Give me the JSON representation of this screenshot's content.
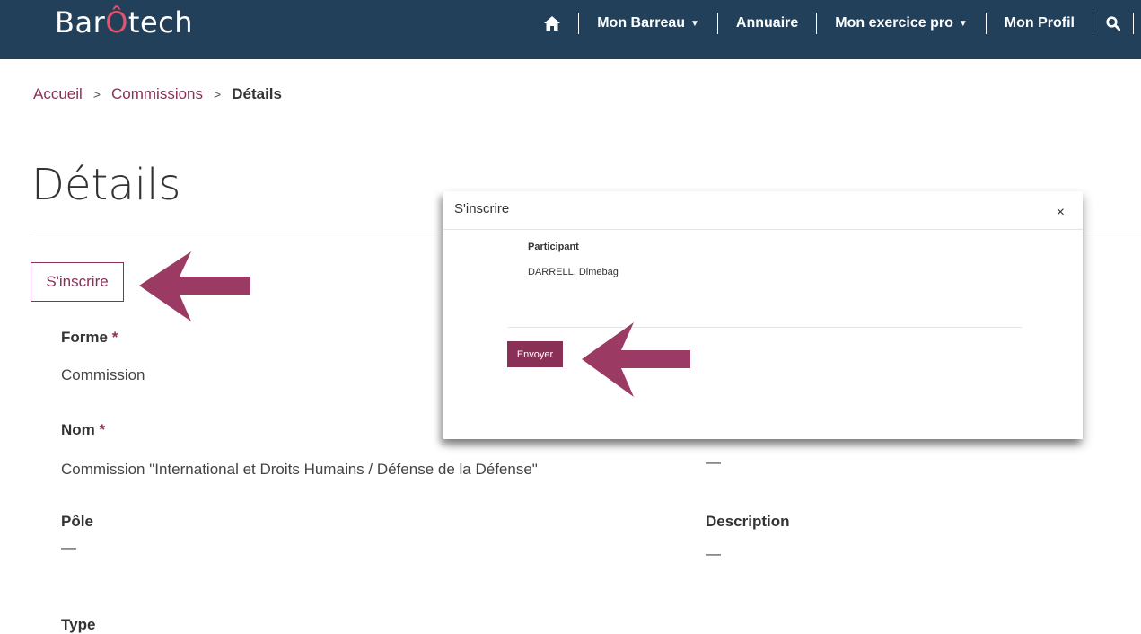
{
  "brand": {
    "logo_prefix": "Bar",
    "logo_accent": "Ô",
    "logo_suffix": "tech"
  },
  "nav": {
    "items": [
      {
        "label": "Mon Barreau",
        "has_caret": true
      },
      {
        "label": "Annuaire",
        "has_caret": false
      },
      {
        "label": "Mon exercice pro",
        "has_caret": true
      },
      {
        "label": "Mon Profil",
        "has_caret": false
      }
    ]
  },
  "breadcrumb": {
    "home": "Accueil",
    "section": "Commissions",
    "current": "Détails",
    "separator": ">"
  },
  "page": {
    "title": "Détails",
    "subscribe_label": "S'inscrire"
  },
  "fields": {
    "forme": {
      "label": "Forme",
      "required_mark": "*",
      "value": "Commission"
    },
    "nom": {
      "label": "Nom",
      "required_mark": "*",
      "value": "Commission \"International et Droits Humains / Défense de la Défense\""
    },
    "pole": {
      "label": "Pôle",
      "value": "—"
    },
    "description": {
      "label": "Description",
      "value": "—"
    },
    "hidden_right": {
      "value": "—"
    },
    "type": {
      "label": "Type"
    }
  },
  "modal": {
    "title": "S'inscrire",
    "close_glyph": "×",
    "participant_label": "Participant",
    "participant_name": "DARRELL, Dimebag",
    "submit_label": "Envoyer"
  },
  "colors": {
    "navbar": "#22405a",
    "accent": "#8a2f55",
    "logo_accent": "#e6516d",
    "annotation_arrow": "#9b3a62"
  }
}
